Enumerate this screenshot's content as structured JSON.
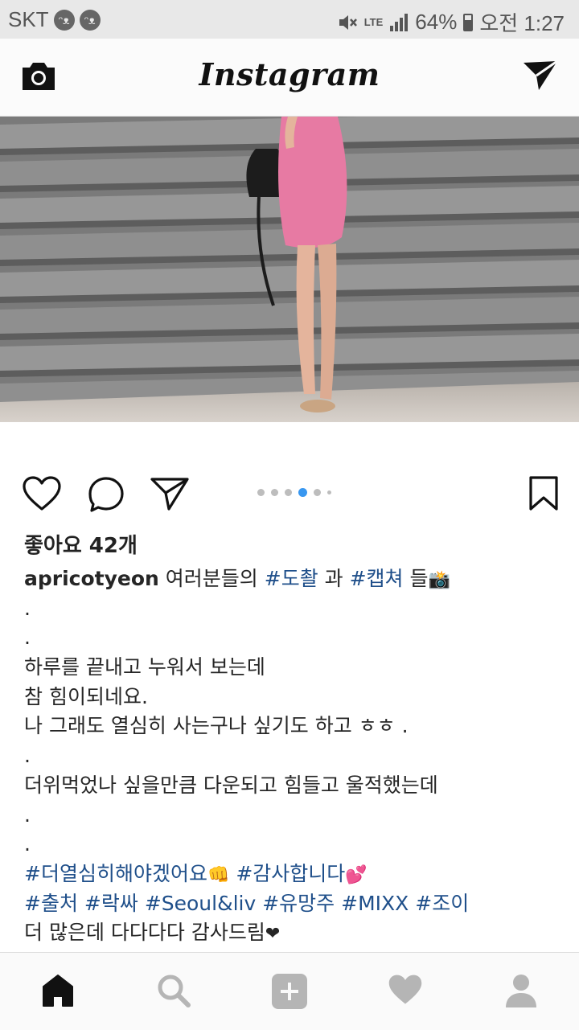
{
  "status_bar": {
    "carrier": "SKT",
    "network": "LTE",
    "battery": "64%",
    "battery_level": 0.64,
    "time": "오전 1:27"
  },
  "header": {
    "logo": "Instagram",
    "camera_icon": "camera-icon",
    "direct_icon": "paper-plane-icon"
  },
  "post": {
    "image_description": "photo",
    "carousel": {
      "count": 6,
      "active_index": 3
    },
    "likes": "좋아요 42개",
    "caption": {
      "username": "apricotyeon",
      "lines": [
        [
          {
            "t": "여러분들의 "
          },
          {
            "t": "#도촬",
            "tag": true
          },
          {
            "t": " 과 "
          },
          {
            "t": "#캡쳐",
            "tag": true
          },
          {
            "t": " 들"
          },
          {
            "t": "📸",
            "emo": true
          }
        ],
        [
          {
            "t": "."
          }
        ],
        [
          {
            "t": "."
          }
        ],
        [
          {
            "t": "하루를 끝내고 누워서 보는데"
          }
        ],
        [
          {
            "t": "참 힘이되네요."
          }
        ],
        [
          {
            "t": "나 그래도 열심히 사는구나 싶기도 하고 ㅎㅎ ."
          }
        ],
        [
          {
            "t": "."
          }
        ],
        [
          {
            "t": "더위먹었나 싶을만큼 다운되고 힘들고 울적했는데"
          }
        ],
        [
          {
            "t": "."
          }
        ],
        [
          {
            "t": "."
          }
        ],
        [
          {
            "t": "#더열심히해야겠어요",
            "tag": true
          },
          {
            "t": "👊",
            "emo": true
          },
          {
            "t": " "
          },
          {
            "t": "#감사합니다",
            "tag": true
          },
          {
            "t": "💕",
            "emo": true
          }
        ],
        [
          {
            "t": "#출처",
            "tag": true
          },
          {
            "t": " "
          },
          {
            "t": "#락싸",
            "tag": true
          },
          {
            "t": " "
          },
          {
            "t": "#Seoul&liv",
            "tag": true
          },
          {
            "t": " "
          },
          {
            "t": "#유망주",
            "tag": true
          },
          {
            "t": " "
          },
          {
            "t": "#MIXX",
            "tag": true
          },
          {
            "t": " "
          },
          {
            "t": "#조이",
            "tag": true
          }
        ],
        [
          {
            "t": "더 많은데 다다다다 감사드림"
          },
          {
            "t": "❤",
            "emo": true
          }
        ]
      ]
    }
  },
  "bottom_nav": {
    "items": [
      "home-icon",
      "search-icon",
      "add-post-icon",
      "activity-heart-icon",
      "profile-icon"
    ],
    "active": "home-icon"
  },
  "colors": {
    "hashtag": "#1f4f8a",
    "carousel_active": "#3897f0",
    "status_bar_bg": "#e8e8e8"
  }
}
